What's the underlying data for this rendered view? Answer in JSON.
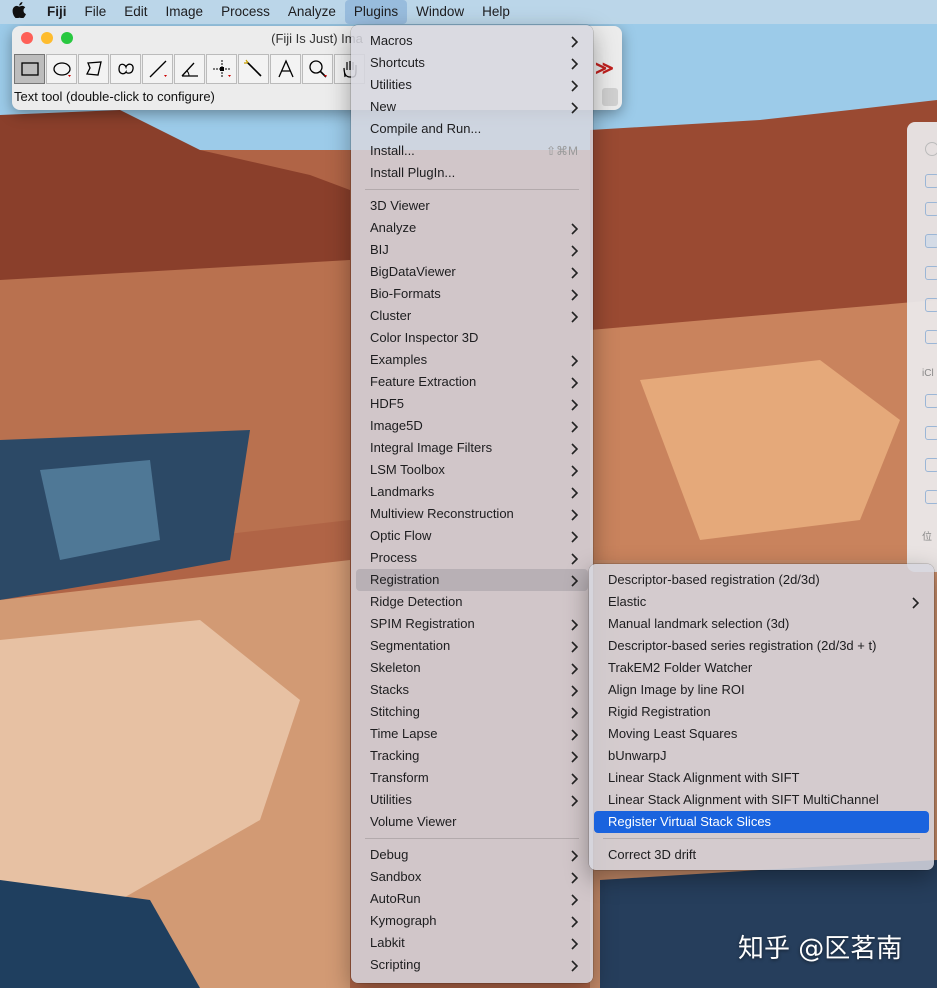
{
  "menubar": {
    "apple": "",
    "items": [
      "Fiji",
      "File",
      "Edit",
      "Image",
      "Process",
      "Analyze",
      "Plugins",
      "Window",
      "Help"
    ]
  },
  "fiji_window": {
    "title": "(Fiji Is Just) Ima",
    "status": "Text tool (double-click to configure)",
    "more_tools": "≫",
    "tools": [
      "rectangle-tool",
      "oval-tool",
      "polygon-tool",
      "freehand-tool",
      "line-tool",
      "angle-tool",
      "point-tool",
      "wand-tool",
      "text-tool",
      "magnifier-tool",
      "hand-tool"
    ]
  },
  "plugins_menu": {
    "items": [
      {
        "label": "Macros",
        "arrow": true
      },
      {
        "label": "Shortcuts",
        "arrow": true
      },
      {
        "label": "Utilities",
        "arrow": true
      },
      {
        "label": "New",
        "arrow": true
      },
      {
        "label": "Compile and Run..."
      },
      {
        "label": "Install...",
        "shortcut": "⇧⌘M"
      },
      {
        "label": "Install PlugIn..."
      },
      {
        "sep": true
      },
      {
        "label": "3D Viewer"
      },
      {
        "label": "Analyze",
        "arrow": true
      },
      {
        "label": "BIJ",
        "arrow": true
      },
      {
        "label": "BigDataViewer",
        "arrow": true
      },
      {
        "label": "Bio-Formats",
        "arrow": true
      },
      {
        "label": "Cluster",
        "arrow": true
      },
      {
        "label": "Color Inspector 3D"
      },
      {
        "label": "Examples",
        "arrow": true
      },
      {
        "label": "Feature Extraction",
        "arrow": true
      },
      {
        "label": "HDF5",
        "arrow": true
      },
      {
        "label": "Image5D",
        "arrow": true
      },
      {
        "label": "Integral Image Filters",
        "arrow": true
      },
      {
        "label": "LSM Toolbox",
        "arrow": true
      },
      {
        "label": "Landmarks",
        "arrow": true
      },
      {
        "label": "Multiview Reconstruction",
        "arrow": true
      },
      {
        "label": "Optic Flow",
        "arrow": true
      },
      {
        "label": "Process",
        "arrow": true
      },
      {
        "label": "Registration",
        "arrow": true,
        "highlight": true
      },
      {
        "label": "Ridge Detection"
      },
      {
        "label": "SPIM Registration",
        "arrow": true
      },
      {
        "label": "Segmentation",
        "arrow": true
      },
      {
        "label": "Skeleton",
        "arrow": true
      },
      {
        "label": "Stacks",
        "arrow": true
      },
      {
        "label": "Stitching",
        "arrow": true
      },
      {
        "label": "Time Lapse",
        "arrow": true
      },
      {
        "label": "Tracking",
        "arrow": true
      },
      {
        "label": "Transform",
        "arrow": true
      },
      {
        "label": "Utilities",
        "arrow": true
      },
      {
        "label": "Volume Viewer"
      },
      {
        "sep": true
      },
      {
        "label": "Debug",
        "arrow": true
      },
      {
        "label": "Sandbox",
        "arrow": true
      },
      {
        "label": "AutoRun",
        "arrow": true
      },
      {
        "label": "Kymograph",
        "arrow": true
      },
      {
        "label": "Labkit",
        "arrow": true
      },
      {
        "label": "Scripting",
        "arrow": true
      }
    ]
  },
  "registration_menu": {
    "items": [
      {
        "label": "Descriptor-based registration (2d/3d)"
      },
      {
        "label": "Elastic",
        "arrow": true
      },
      {
        "label": "Manual landmark selection (3d)"
      },
      {
        "label": "Descriptor-based series registration (2d/3d + t)"
      },
      {
        "label": "TrakEM2 Folder Watcher"
      },
      {
        "label": "Align Image by line ROI"
      },
      {
        "label": "Rigid Registration"
      },
      {
        "label": "Moving Least Squares"
      },
      {
        "label": "bUnwarpJ"
      },
      {
        "label": "Linear Stack Alignment with SIFT"
      },
      {
        "label": "Linear Stack Alignment with SIFT MultiChannel"
      },
      {
        "label": "Register Virtual Stack Slices",
        "selected": true
      },
      {
        "sep": true
      },
      {
        "label": "Correct 3D drift"
      }
    ]
  },
  "finder_fragment": {
    "labels": [
      "iCl",
      "位"
    ]
  },
  "watermark": "知乎 @区茗南",
  "colors": {
    "selection": "#1a63de",
    "menu_bg": "rgba(214,214,222,0.86)"
  }
}
